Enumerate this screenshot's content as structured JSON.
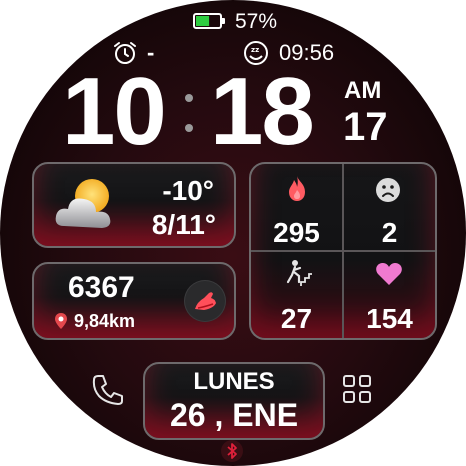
{
  "battery": {
    "percent_text": "57%",
    "level": 0.57,
    "fill_color": "#2ecc40"
  },
  "alarm": {
    "value": "-",
    "icon": "alarm-clock-icon"
  },
  "sleep": {
    "time": "09:56",
    "icon": "sleep-icon"
  },
  "time": {
    "hours": "10",
    "separator": ":",
    "minutes": "18",
    "ampm": "AM",
    "seconds": "17"
  },
  "weather": {
    "temp": "-10°",
    "range": "8/11°",
    "icon": "partly-cloudy-icon"
  },
  "steps": {
    "count": "6367",
    "distance": "9,84km",
    "distance_icon": "location-pin-icon",
    "shoe_icon": "running-shoe-icon"
  },
  "stats": {
    "calories": {
      "value": "295",
      "icon": "flame-icon"
    },
    "stress": {
      "value": "2",
      "icon": "sad-face-icon"
    },
    "floors": {
      "value": "27",
      "icon": "stairs-climber-icon"
    },
    "heart": {
      "value": "154",
      "icon": "heart-icon"
    }
  },
  "date": {
    "weekday": "LUNES",
    "day_month": "26 , ENE"
  },
  "shortcuts": {
    "left_icon": "phone-icon",
    "right_icon": "apps-grid-icon",
    "bottom_icon": "bluetooth-icon"
  },
  "colors": {
    "accent": "#e0203a",
    "panel_border": "#6e6a6c",
    "background": "#1c080c"
  }
}
